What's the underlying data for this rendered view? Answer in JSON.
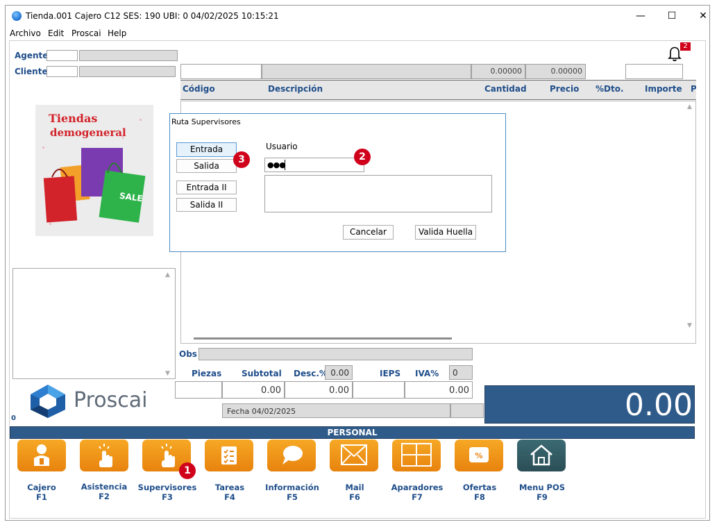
{
  "window": {
    "title": "Tienda.001  Cajero C12     SES: 190   UBI: 0   04/02/2025 10:15:21",
    "minimize": "—",
    "maximize": "☐",
    "close": "✕"
  },
  "menu": [
    "Archivo",
    "Edit",
    "Proscai",
    "Help"
  ],
  "header": {
    "agente_label": "Agente",
    "cliente_label": "Cliente",
    "notification_count": "2",
    "value1": "0.00000",
    "value2": "0.00000"
  },
  "grid": {
    "columns": [
      "Código",
      "Descripción",
      "Cantidad",
      "Precio",
      "%Dto.",
      "Importe",
      "P"
    ]
  },
  "store_image": {
    "line1": "Tiendas",
    "line2": "demogeneral",
    "sale": "SALE"
  },
  "dialog": {
    "title": "Ruta Supervisores",
    "buttons": [
      "Entrada",
      "Salida",
      "Entrada II",
      "Salida II"
    ],
    "usuario_label": "Usuario",
    "usuario_value": "●●●",
    "cancel": "Cancelar",
    "valida": "Valida Huella"
  },
  "markers": {
    "m1": "1",
    "m2": "2",
    "m3": "3"
  },
  "totals": {
    "obs_label": "Obs",
    "piezas_label": "Piezas",
    "subtotal_label": "Subtotal",
    "desc_label": "Desc.%",
    "desc_value": "0.00",
    "ieps_label": "IEPS",
    "iva_label": "IVA%",
    "iva_value": "0",
    "subtotal_value": "0.00",
    "desc_amount": "0.00",
    "ieps_amount": "0.00",
    "fecha": "Fecha 04/02/2025",
    "total": "0.00"
  },
  "brand": {
    "name": "Proscai",
    "zero": "0"
  },
  "section_label": "PERSONAL",
  "fkeys": [
    {
      "label": "Cajero",
      "key": "F1"
    },
    {
      "label": "Asistencia",
      "key": "F2"
    },
    {
      "label": "Supervisores",
      "key": "F3"
    },
    {
      "label": "Tareas",
      "key": "F4"
    },
    {
      "label": "Información",
      "key": "F5"
    },
    {
      "label": "Mail",
      "key": "F6"
    },
    {
      "label": "Aparadores",
      "key": "F7"
    },
    {
      "label": "Ofertas",
      "key": "F8"
    },
    {
      "label": "Menu POS",
      "key": "F9"
    }
  ],
  "colors": {
    "accent_blue": "#1f4e8a",
    "total_bg": "#2f5b8a",
    "orange": "#f39a1e",
    "marker_red": "#d0021b"
  }
}
